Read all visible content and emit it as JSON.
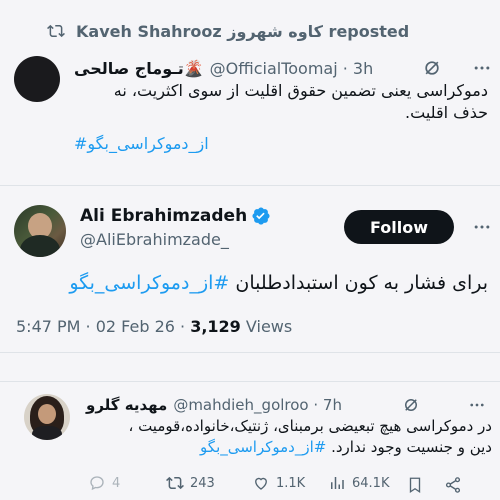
{
  "repost": {
    "label": "Kaveh Shahrooz کاوه شهروز reposted"
  },
  "tweet1": {
    "display_name": "تـوماج صالحی🌋",
    "handle_time": "@OfficialToomaj · 3h",
    "line1": "دموکراسی یعنی تضمین حقوق اقلیت از سوی اکثریت، نه",
    "line2": "حذف اقلیت.",
    "hashtag": "#از_دموکراسی_بگو"
  },
  "main": {
    "name": "Ali Ebrahimzadeh",
    "handle": "@AliEbrahimzade_",
    "follow_label": "Follow",
    "text_prefix": "برای فشار به کون استبدادطلبان ",
    "hashtag": "#از_دموکراسی_بگو",
    "time_date": "5:47 PM · 02 Feb 26 · ",
    "views_count": "3,129",
    "views_label": " Views"
  },
  "reply": {
    "display_name": "مهدیه گلرو",
    "handle_time": "@mahdieh_golroo · 7h",
    "line1": "در دموکراسی هیچ تبعیضی برمبنای، ژنتیک،خانواده،قومیت ،",
    "line2_text": "دین و جنسیت وجود ندارد. ",
    "hashtag": "#از_دموکراسی_بگو",
    "actions": {
      "replies": "4",
      "reposts": "243",
      "likes": "1.1K",
      "views": "64.1K"
    }
  },
  "colors": {
    "accent": "#1d9bf0",
    "verified": "#1d9bf0",
    "text": "#0f1419",
    "muted": "#536471"
  }
}
